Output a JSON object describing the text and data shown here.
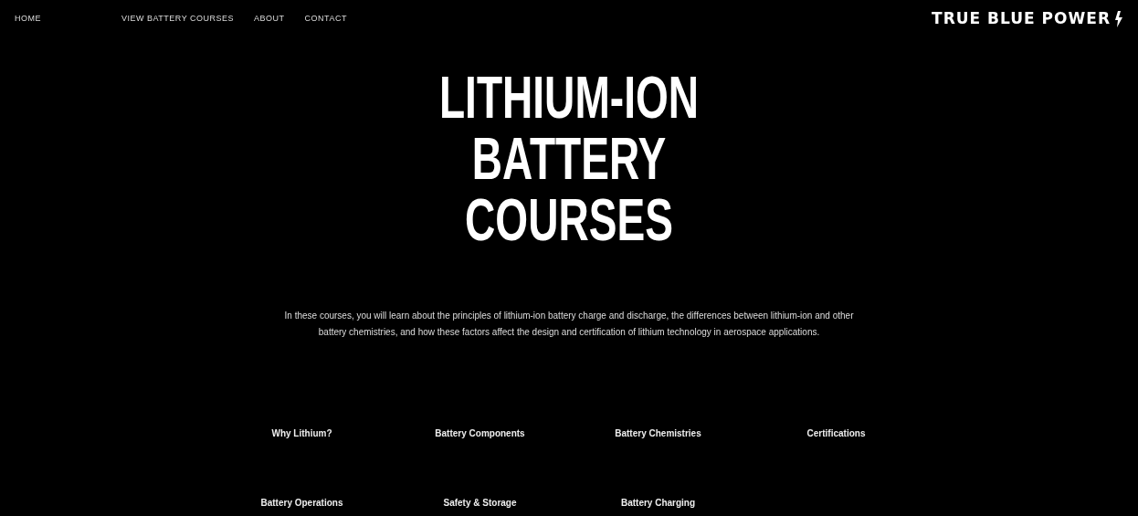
{
  "nav": {
    "links": [
      {
        "label": "HOME"
      },
      {
        "label": "VIEW BATTERY COURSES"
      },
      {
        "label": "ABOUT"
      },
      {
        "label": "CONTACT"
      }
    ],
    "logo": "TRUE BLUE POWER"
  },
  "hero": {
    "title": "LITHIUM-ION BATTERY COURSES",
    "intro": "In these courses, you will learn about the principles of lithium-ion battery charge and discharge, the differences between lithium-ion and other battery chemistries, and how these factors affect the design and certification of lithium technology in aerospace applications."
  },
  "courses": [
    {
      "title": "Why Lithium?"
    },
    {
      "title": "Battery Components"
    },
    {
      "title": "Battery Chemistries"
    },
    {
      "title": "Certifications"
    },
    {
      "title": "Battery Operations"
    },
    {
      "title": "Safety & Storage"
    },
    {
      "title": "Battery Charging"
    }
  ]
}
